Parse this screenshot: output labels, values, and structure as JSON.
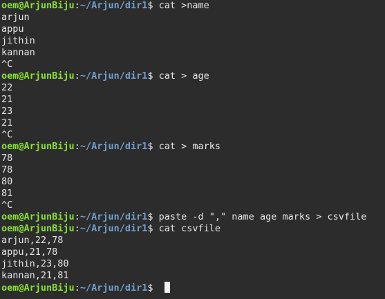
{
  "terminal": {
    "prompt": {
      "user_host": "oem@ArjunBiju",
      "colon": ":",
      "path": "~/Arjun/dir1",
      "dollar": "$"
    },
    "lines": [
      {
        "type": "prompt",
        "command": "cat >name"
      },
      {
        "type": "output",
        "text": "arjun"
      },
      {
        "type": "output",
        "text": "appu"
      },
      {
        "type": "output",
        "text": "jithin"
      },
      {
        "type": "output",
        "text": "kannan"
      },
      {
        "type": "output",
        "text": "^C"
      },
      {
        "type": "prompt",
        "command": "cat > age"
      },
      {
        "type": "output",
        "text": "22"
      },
      {
        "type": "output",
        "text": "21"
      },
      {
        "type": "output",
        "text": "23"
      },
      {
        "type": "output",
        "text": "21"
      },
      {
        "type": "output",
        "text": "^C"
      },
      {
        "type": "prompt",
        "command": "cat > marks"
      },
      {
        "type": "output",
        "text": "78"
      },
      {
        "type": "output",
        "text": "78"
      },
      {
        "type": "output",
        "text": "80"
      },
      {
        "type": "output",
        "text": "81"
      },
      {
        "type": "output",
        "text": "^C"
      },
      {
        "type": "prompt",
        "command": "paste -d \",\" name age marks > csvfile"
      },
      {
        "type": "prompt",
        "command": "cat csvfile"
      },
      {
        "type": "output",
        "text": "arjun,22,78"
      },
      {
        "type": "output",
        "text": "appu,21,78"
      },
      {
        "type": "output",
        "text": "jithin,23,80"
      },
      {
        "type": "output",
        "text": "kannan,21,81"
      },
      {
        "type": "prompt",
        "command": "",
        "cursor": true
      }
    ]
  },
  "colors": {
    "background": "#2c2c2c",
    "user_host": "#8ae234",
    "path": "#729fcf",
    "text": "#e6e6e6"
  }
}
